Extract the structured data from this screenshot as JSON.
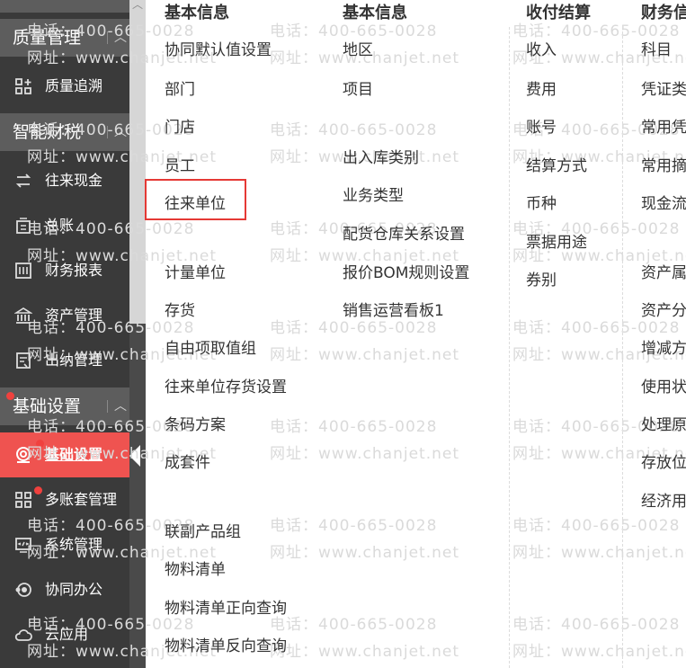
{
  "sidebar": {
    "groups": [
      {
        "label": "质量管理"
      },
      {
        "label": "智能财税"
      },
      {
        "label": "基础设置"
      }
    ],
    "items": [
      {
        "label": "质量追溯",
        "icon": "grid-icon"
      },
      {
        "label": "往来现金",
        "icon": "exchange-icon"
      },
      {
        "label": "总账",
        "icon": "ledger-icon"
      },
      {
        "label": "财务报表",
        "icon": "report-icon"
      },
      {
        "label": "资产管理",
        "icon": "bank-icon"
      },
      {
        "label": "出纳管理",
        "icon": "cashier-icon"
      },
      {
        "label": "基础设置",
        "icon": "settings-icon"
      },
      {
        "label": "多账套管理",
        "icon": "multi-account-icon"
      },
      {
        "label": "系统管理",
        "icon": "system-icon"
      },
      {
        "label": "协同办公",
        "icon": "collab-icon"
      },
      {
        "label": "云应用",
        "icon": "cloud-icon"
      }
    ],
    "active_color": "#ef5350"
  },
  "columns": [
    {
      "title": "基本信息",
      "items": [
        "协同默认值设置",
        "部门",
        "门店",
        "员工",
        "往来单位",
        "计量单位",
        "存货",
        "自由项取值组",
        "往来单位存货设置",
        "条码方案",
        "成套件",
        "联副产品组",
        "物料清单",
        "物料清单正向查询",
        "物料清单反向查询"
      ]
    },
    {
      "title": "基本信息",
      "items": [
        "地区",
        "项目",
        "出入库类别",
        "业务类型",
        "配货仓库关系设置",
        "报价BOM规则设置",
        "销售运营看板1"
      ]
    },
    {
      "title": "收付结算",
      "items": [
        "收入",
        "费用",
        "账号",
        "结算方式",
        "币种",
        "票据用途",
        "券别"
      ]
    },
    {
      "title": "财务信",
      "items": [
        "科目",
        "凭证类",
        "常用凭",
        "常用摘",
        "现金流",
        "资产属",
        "资产分",
        "增减方",
        "使用状",
        "处理原",
        "存放位",
        "经济用"
      ]
    }
  ],
  "watermark": {
    "phone": "电话：400-665-0028",
    "web": "网址：www.chanjet.net"
  }
}
